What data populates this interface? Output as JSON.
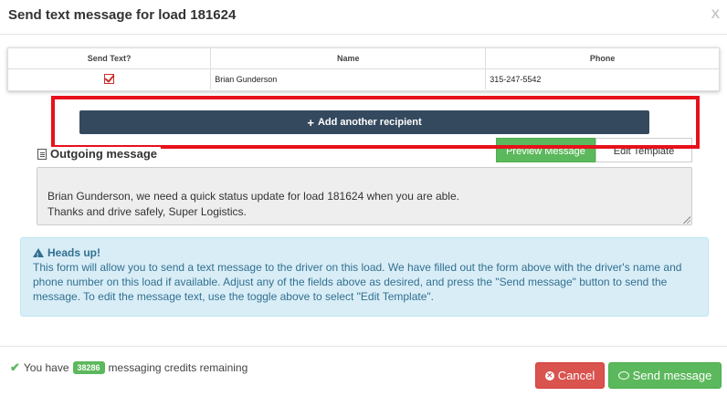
{
  "modal": {
    "title": "Send text message for load 181624",
    "close_label": "X"
  },
  "recipients_table": {
    "headers": [
      "Send Text?",
      "Name",
      "Phone"
    ],
    "rows": [
      {
        "send_text": true,
        "name": "Brian Gunderson",
        "phone": "315-247-5542"
      }
    ]
  },
  "add_recipient": {
    "label": "Add another recipient",
    "icon": "plus-icon"
  },
  "outgoing": {
    "label": "Outgoing message",
    "icon": "document-icon",
    "preview_label": "Preview Message",
    "edit_label": "Edit Template",
    "message": "Brian Gunderson, we need a quick status update for load 181624 when you are able.\nThanks and drive safely, Super Logistics."
  },
  "alert": {
    "title": "Heads up!",
    "icon": "warning-icon",
    "body": "This form will allow you to send a text message to the driver on this load. We have filled out the form above with the driver's name and phone number on this load if available. Adjust any of the fields above as desired, and press the \"Send message\" button to send the message. To edit the message text, use the toggle above to select \"Edit Template\"."
  },
  "footer": {
    "credits_prefix": "You have",
    "credits_count": "38286",
    "credits_suffix": "messaging credits remaining",
    "cancel_label": "Cancel",
    "send_label": "Send message"
  },
  "colors": {
    "primary_dark": "#34495e",
    "success": "#5cb85c",
    "danger": "#d9534f",
    "info_bg": "#d9edf7",
    "info_text": "#31708f",
    "highlight": "#e8101b"
  }
}
